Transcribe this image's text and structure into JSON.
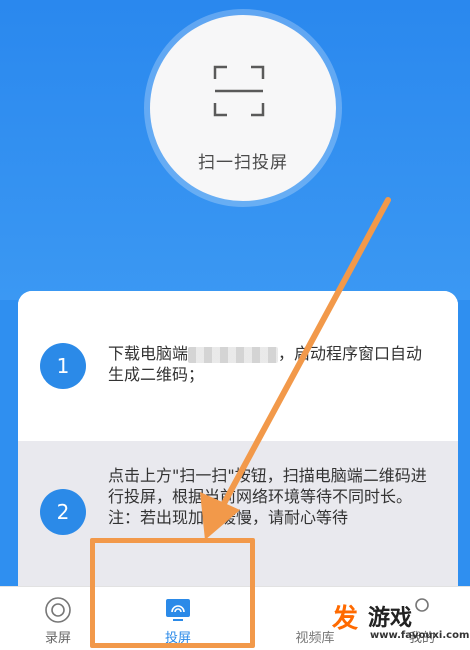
{
  "scan": {
    "label": "扫一扫投屏",
    "icon": "scan-frame-icon"
  },
  "steps": [
    {
      "number": "1",
      "text_before": "下载电脑端",
      "text_after": "，启动程序窗口自动生成二维码；"
    },
    {
      "number": "2",
      "text": "点击上方\"扫一扫\"按钮，扫描电脑端二维码进行投屏，根据当前网络环境等待不同时长。注：若出现加载缓慢，请耐心等待"
    }
  ],
  "tabbar": {
    "items": [
      {
        "label": "录屏",
        "icon": "record-icon"
      },
      {
        "label": "投屏",
        "icon": "cast-screen-icon",
        "active": true
      },
      {
        "label": "视频库",
        "icon": "video-library-icon"
      },
      {
        "label": "我的",
        "icon": "profile-icon"
      }
    ]
  },
  "watermark": {
    "logo": "发",
    "title": "游戏",
    "url": "www.favouxi.com"
  },
  "colors": {
    "accent": "#2b8ae8",
    "background": "#2f8ff0",
    "annotation": "#f2994a"
  }
}
